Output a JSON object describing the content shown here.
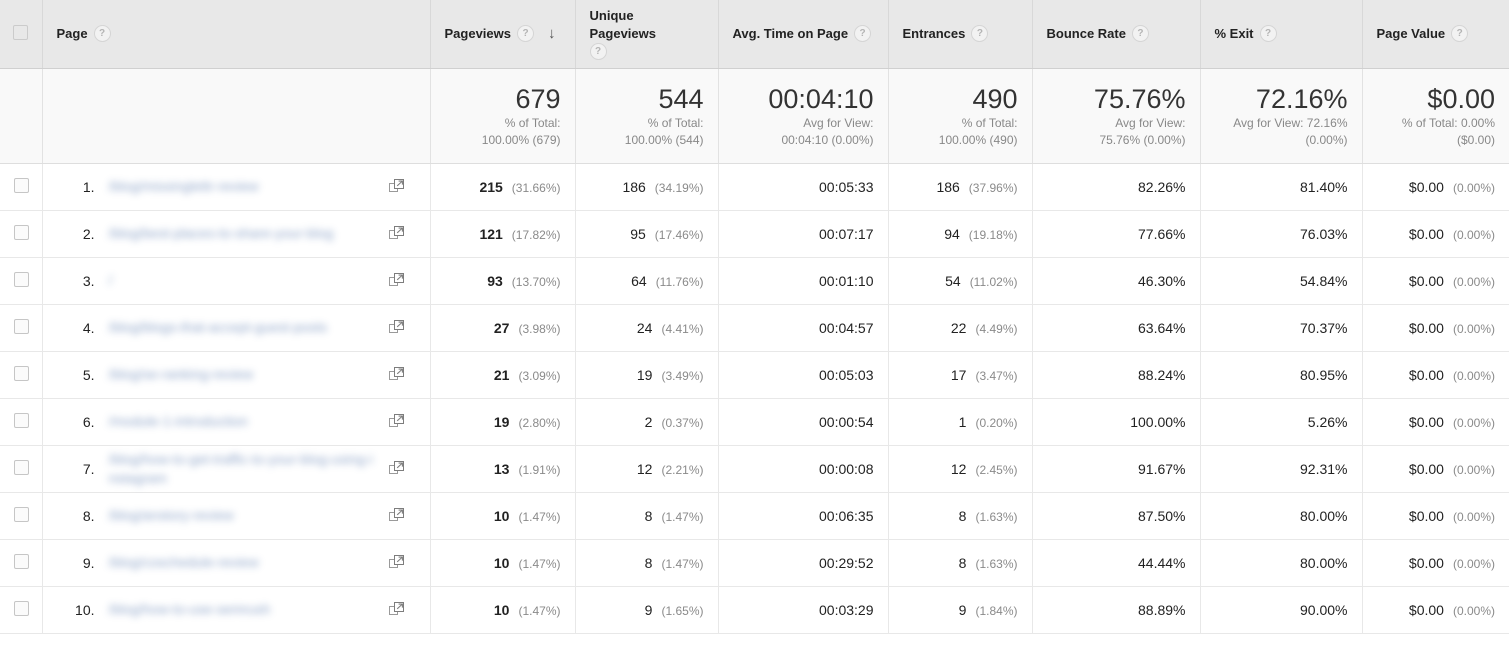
{
  "table": {
    "columns": [
      {
        "key": "page",
        "label": "Page",
        "help": "?",
        "sorted": false
      },
      {
        "key": "pageviews",
        "label": "Pageviews",
        "help": "?",
        "sorted": true,
        "sort_arrow": "↓"
      },
      {
        "key": "unique_pageviews",
        "label": "Unique Pageviews",
        "help": "?",
        "sorted": false
      },
      {
        "key": "avg_time",
        "label": "Avg. Time on Page",
        "help": "?",
        "sorted": false
      },
      {
        "key": "entrances",
        "label": "Entrances",
        "help": "?",
        "sorted": false
      },
      {
        "key": "bounce_rate",
        "label": "Bounce Rate",
        "help": "?",
        "sorted": false
      },
      {
        "key": "exit_pct",
        "label": "% Exit",
        "help": "?",
        "sorted": false
      },
      {
        "key": "page_value",
        "label": "Page Value",
        "help": "?",
        "sorted": false
      }
    ],
    "summary": {
      "pageviews": {
        "value": "679",
        "line1": "% of Total:",
        "line2": "100.00% (679)"
      },
      "unique_pageviews": {
        "value": "544",
        "line1": "% of Total:",
        "line2": "100.00% (544)"
      },
      "avg_time": {
        "value": "00:04:10",
        "line1": "Avg for View:",
        "line2": "00:04:10 (0.00%)"
      },
      "entrances": {
        "value": "490",
        "line1": "% of Total:",
        "line2": "100.00% (490)"
      },
      "bounce_rate": {
        "value": "75.76%",
        "line1": "Avg for View:",
        "line2": "75.76% (0.00%)"
      },
      "exit_pct": {
        "value": "72.16%",
        "line1": "Avg for View: 72.16%",
        "line2": "(0.00%)"
      },
      "page_value": {
        "value": "$0.00",
        "line1": "% of Total: 0.00%",
        "line2": "($0.00)"
      }
    },
    "rows": [
      {
        "index": "1.",
        "page": "/blog/missinglettr-review",
        "pageviews": "215",
        "pageviews_pct": "(31.66%)",
        "unique_pageviews": "186",
        "unique_pageviews_pct": "(34.19%)",
        "avg_time": "00:05:33",
        "entrances": "186",
        "entrances_pct": "(37.96%)",
        "bounce_rate": "82.26%",
        "exit_pct": "81.40%",
        "page_value": "$0.00",
        "page_value_pct": "(0.00%)"
      },
      {
        "index": "2.",
        "page": "/blog/best-places-to-share-your-blog",
        "pageviews": "121",
        "pageviews_pct": "(17.82%)",
        "unique_pageviews": "95",
        "unique_pageviews_pct": "(17.46%)",
        "avg_time": "00:07:17",
        "entrances": "94",
        "entrances_pct": "(19.18%)",
        "bounce_rate": "77.66%",
        "exit_pct": "76.03%",
        "page_value": "$0.00",
        "page_value_pct": "(0.00%)"
      },
      {
        "index": "3.",
        "page": "/",
        "pageviews": "93",
        "pageviews_pct": "(13.70%)",
        "unique_pageviews": "64",
        "unique_pageviews_pct": "(11.76%)",
        "avg_time": "00:01:10",
        "entrances": "54",
        "entrances_pct": "(11.02%)",
        "bounce_rate": "46.30%",
        "exit_pct": "54.84%",
        "page_value": "$0.00",
        "page_value_pct": "(0.00%)"
      },
      {
        "index": "4.",
        "page": "/blog/blogs-that-accept-guest-posts",
        "pageviews": "27",
        "pageviews_pct": "(3.98%)",
        "unique_pageviews": "24",
        "unique_pageviews_pct": "(4.41%)",
        "avg_time": "00:04:57",
        "entrances": "22",
        "entrances_pct": "(4.49%)",
        "bounce_rate": "63.64%",
        "exit_pct": "70.37%",
        "page_value": "$0.00",
        "page_value_pct": "(0.00%)"
      },
      {
        "index": "5.",
        "page": "/blog/se-ranking-review",
        "pageviews": "21",
        "pageviews_pct": "(3.09%)",
        "unique_pageviews": "19",
        "unique_pageviews_pct": "(3.49%)",
        "avg_time": "00:05:03",
        "entrances": "17",
        "entrances_pct": "(3.47%)",
        "bounce_rate": "88.24%",
        "exit_pct": "80.95%",
        "page_value": "$0.00",
        "page_value_pct": "(0.00%)"
      },
      {
        "index": "6.",
        "page": "/module-1-introduction",
        "pageviews": "19",
        "pageviews_pct": "(2.80%)",
        "unique_pageviews": "2",
        "unique_pageviews_pct": "(0.37%)",
        "avg_time": "00:00:54",
        "entrances": "1",
        "entrances_pct": "(0.20%)",
        "bounce_rate": "100.00%",
        "exit_pct": "5.26%",
        "page_value": "$0.00",
        "page_value_pct": "(0.00%)"
      },
      {
        "index": "7.",
        "page": "/blog/how-to-get-traffic-to-your-blog-using-instagram",
        "pageviews": "13",
        "pageviews_pct": "(1.91%)",
        "unique_pageviews": "12",
        "unique_pageviews_pct": "(2.21%)",
        "avg_time": "00:00:08",
        "entrances": "12",
        "entrances_pct": "(2.45%)",
        "bounce_rate": "91.67%",
        "exit_pct": "92.31%",
        "page_value": "$0.00",
        "page_value_pct": "(0.00%)"
      },
      {
        "index": "8.",
        "page": "/blog/anstory-review",
        "pageviews": "10",
        "pageviews_pct": "(1.47%)",
        "unique_pageviews": "8",
        "unique_pageviews_pct": "(1.47%)",
        "avg_time": "00:06:35",
        "entrances": "8",
        "entrances_pct": "(1.63%)",
        "bounce_rate": "87.50%",
        "exit_pct": "80.00%",
        "page_value": "$0.00",
        "page_value_pct": "(0.00%)"
      },
      {
        "index": "9.",
        "page": "/blog/coschedule-review",
        "pageviews": "10",
        "pageviews_pct": "(1.47%)",
        "unique_pageviews": "8",
        "unique_pageviews_pct": "(1.47%)",
        "avg_time": "00:29:52",
        "entrances": "8",
        "entrances_pct": "(1.63%)",
        "bounce_rate": "44.44%",
        "exit_pct": "80.00%",
        "page_value": "$0.00",
        "page_value_pct": "(0.00%)"
      },
      {
        "index": "10.",
        "page": "/blog/how-to-use-semrush",
        "pageviews": "10",
        "pageviews_pct": "(1.47%)",
        "unique_pageviews": "9",
        "unique_pageviews_pct": "(1.65%)",
        "avg_time": "00:03:29",
        "entrances": "9",
        "entrances_pct": "(1.84%)",
        "bounce_rate": "88.89%",
        "exit_pct": "90.00%",
        "page_value": "$0.00",
        "page_value_pct": "(0.00%)"
      }
    ]
  },
  "icons": {
    "help": "?",
    "sort_descending": "↓",
    "open_in_new": "open-in-new-window-icon"
  },
  "colors": {
    "header_background": "#e8e8e8",
    "summary_background": "#f9f9f9",
    "link": "#4b6ea8",
    "muted_text": "#8a8a8a",
    "border": "#e8e8e8"
  }
}
